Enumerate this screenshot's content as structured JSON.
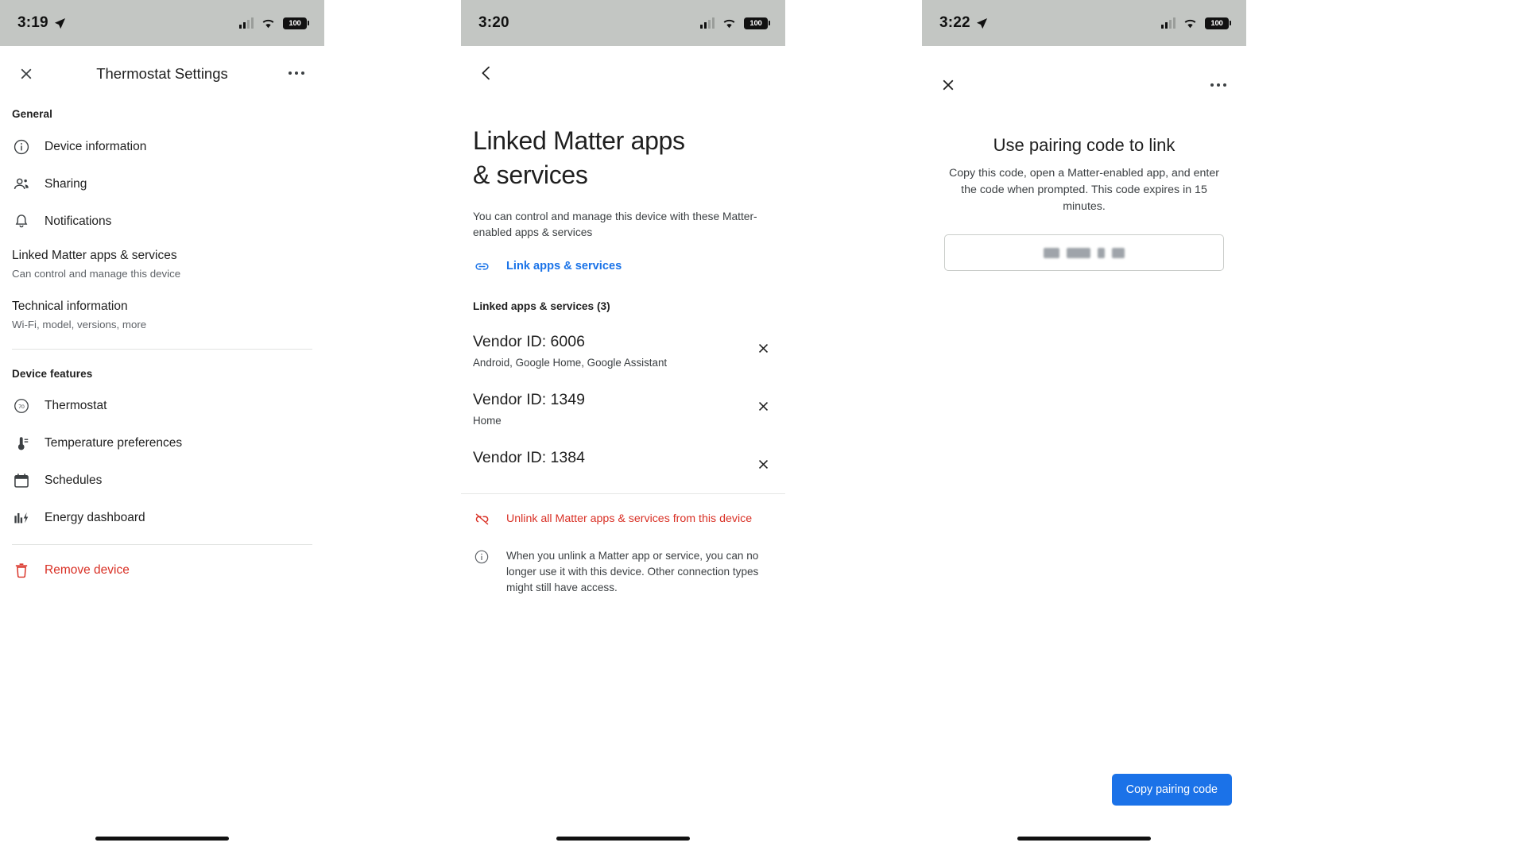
{
  "panel1": {
    "status": {
      "time": "3:19",
      "location_icon": "location-arrow-icon",
      "signal_icon": "cellular-signal-icon",
      "wifi_icon": "wifi-icon",
      "battery": "100"
    },
    "topbar": {
      "close_icon": "close-icon",
      "title": "Thermostat Settings",
      "more_icon": "more-options-icon"
    },
    "general_label": "General",
    "general_items": [
      {
        "icon": "info-circle-icon",
        "label": "Device information"
      },
      {
        "icon": "people-icon",
        "label": "Sharing"
      },
      {
        "icon": "bell-icon",
        "label": "Notifications"
      }
    ],
    "blocks": [
      {
        "title": "Linked Matter apps & services",
        "subtitle": "Can control and manage this device"
      },
      {
        "title": "Technical information",
        "subtitle": "Wi-Fi, model, versions, more"
      }
    ],
    "features_label": "Device features",
    "feature_items": [
      {
        "icon": "thermostat-dial-icon",
        "icon_text": "70",
        "label": "Thermostat"
      },
      {
        "icon": "thermometer-icon",
        "label": "Temperature preferences"
      },
      {
        "icon": "calendar-icon",
        "label": "Schedules"
      },
      {
        "icon": "energy-chart-icon",
        "label": "Energy dashboard"
      }
    ],
    "remove": {
      "icon": "trash-icon",
      "label": "Remove device"
    }
  },
  "panel2": {
    "status": {
      "time": "3:20",
      "signal_icon": "cellular-signal-icon",
      "wifi_icon": "wifi-icon",
      "battery": "100"
    },
    "back_icon": "chevron-left-icon",
    "title": "Linked Matter apps\n& services",
    "title_line1": "Linked Matter apps",
    "title_line2": "& services",
    "subtitle": "You can control and manage this device with these Matter-enabled apps & services",
    "link_action": {
      "icon": "link-icon",
      "label": "Link apps & services"
    },
    "count_label": "Linked apps & services (3)",
    "vendors": [
      {
        "title": "Vendor ID: 6006",
        "subtitle": "Android, Google Home, Google Assistant",
        "remove_icon": "close-icon"
      },
      {
        "title": "Vendor ID: 1349",
        "subtitle": "Home",
        "remove_icon": "close-icon"
      },
      {
        "title": "Vendor ID: 1384",
        "subtitle": "",
        "remove_icon": "close-icon"
      }
    ],
    "unlink": {
      "icon": "link-off-icon",
      "label": "Unlink all Matter apps & services from this device"
    },
    "info": {
      "icon": "info-circle-icon",
      "text": "When you unlink a Matter app or service, you can no longer use it with this device. Other connection types might still have access."
    }
  },
  "panel3": {
    "status": {
      "time": "3:22",
      "location_icon": "location-arrow-icon",
      "signal_icon": "cellular-signal-icon",
      "wifi_icon": "wifi-icon",
      "battery": "100"
    },
    "close_icon": "close-icon",
    "more_icon": "more-options-icon",
    "title": "Use pairing code to link",
    "description": "Copy this code, open a Matter-enabled app, and enter the code when prompted. This code expires in 15 minutes.",
    "code_field": {
      "value": "",
      "masked": true
    },
    "cta_label": "Copy pairing code"
  },
  "colors": {
    "accent_blue": "#1a73e8",
    "danger_red": "#d93025",
    "statusbar_gray": "#c3c6c3",
    "text_primary": "#1f1f1f",
    "text_secondary": "#5f6368"
  }
}
